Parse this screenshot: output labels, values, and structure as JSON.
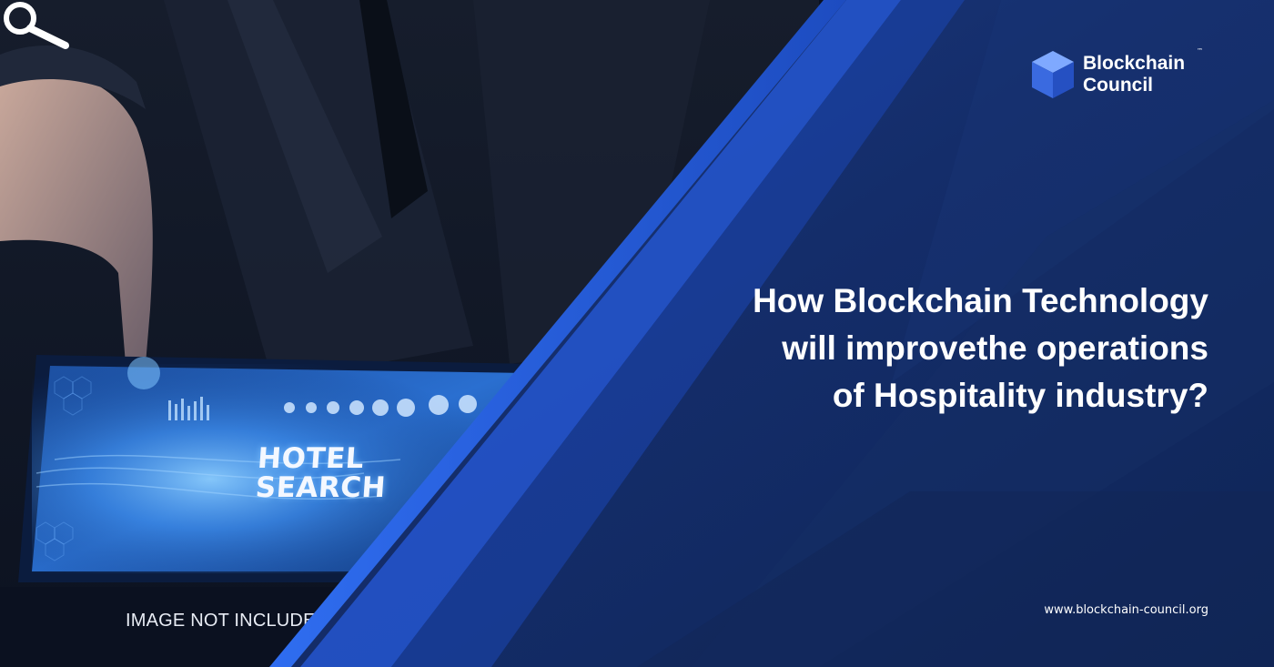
{
  "banner": {
    "tablet": {
      "line1": "HOTEL",
      "line2": "SEARCH"
    },
    "caption": "IMAGE NOT INCLUDED",
    "logo": {
      "line1": "Blockchain",
      "line2": "Council",
      "trademark": "™"
    },
    "headline": {
      "line1": "How Blockchain Technology",
      "line2": "will improvethe operations",
      "line3": "of Hospitality industry?"
    },
    "website": "www.blockchain-council.org"
  },
  "colors": {
    "accent_blue": "#2257d6",
    "panel_dark": "#0f2a66",
    "background": "#0b1120",
    "text": "#ffffff"
  },
  "icons": [
    "search-icon",
    "cube-logo-icon"
  ]
}
